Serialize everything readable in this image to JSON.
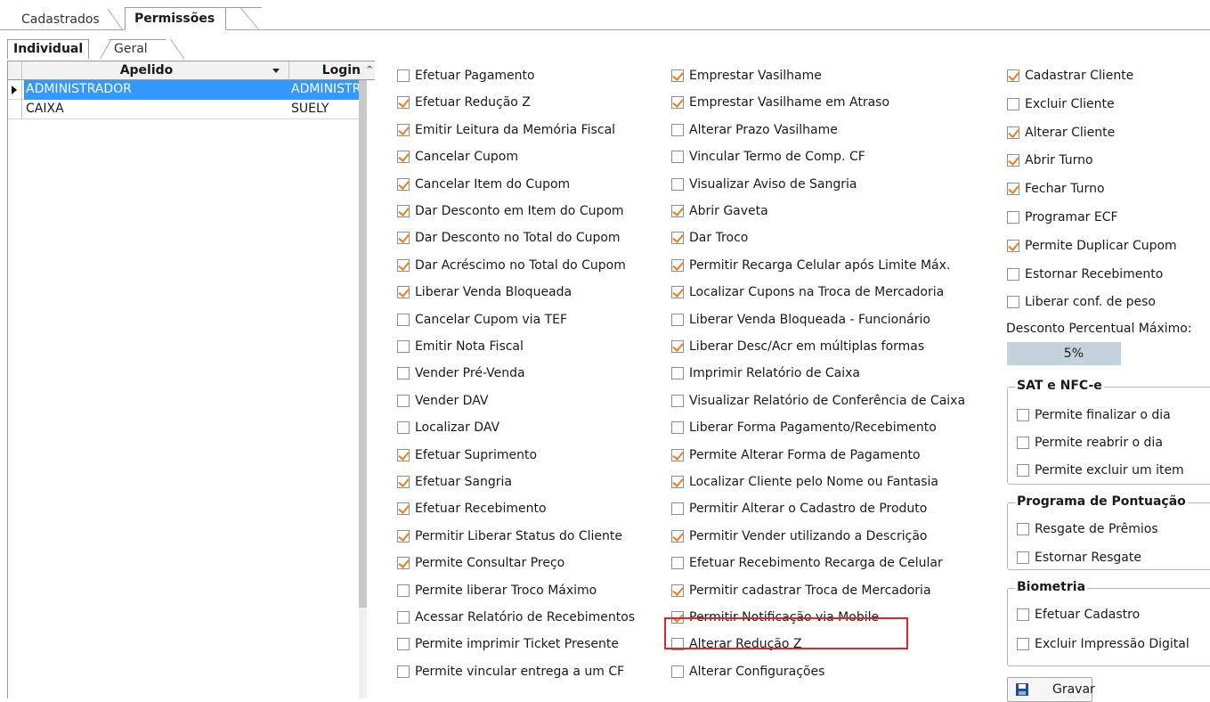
{
  "tabs": {
    "cadastrados": "Cadastrados",
    "permissoes": "Permissões"
  },
  "subtabs": {
    "individual": "Individual",
    "geral": "Geral"
  },
  "grid": {
    "headers": {
      "apelido": "Apelido",
      "login": "Login"
    },
    "rows": [
      {
        "apelido": "ADMINISTRADOR",
        "login": "ADMINISTR",
        "selected": true
      },
      {
        "apelido": "CAIXA",
        "login": "SUELY",
        "selected": false
      }
    ]
  },
  "col1": [
    {
      "label": "Efetuar Pagamento",
      "checked": false
    },
    {
      "label": "Efetuar Redução Z",
      "checked": true
    },
    {
      "label": "Emitir Leitura da Memória Fiscal",
      "checked": true
    },
    {
      "label": "Cancelar Cupom",
      "checked": true
    },
    {
      "label": "Cancelar Item do Cupom",
      "checked": true
    },
    {
      "label": "Dar Desconto em Item do Cupom",
      "checked": true
    },
    {
      "label": "Dar Desconto no Total do Cupom",
      "checked": true
    },
    {
      "label": "Dar Acréscimo no Total do Cupom",
      "checked": true
    },
    {
      "label": "Liberar Venda Bloqueada",
      "checked": true
    },
    {
      "label": "Cancelar Cupom via TEF",
      "checked": false
    },
    {
      "label": "Emitir Nota Fiscal",
      "checked": false
    },
    {
      "label": "Vender Pré-Venda",
      "checked": false
    },
    {
      "label": "Vender DAV",
      "checked": false
    },
    {
      "label": "Localizar DAV",
      "checked": false
    },
    {
      "label": "Efetuar Suprimento",
      "checked": true
    },
    {
      "label": "Efetuar Sangria",
      "checked": true
    },
    {
      "label": "Efetuar Recebimento",
      "checked": true
    },
    {
      "label": "Permitir Liberar Status do Cliente",
      "checked": true
    },
    {
      "label": "Permite Consultar Preço",
      "checked": true
    },
    {
      "label": "Permite liberar Troco Máximo",
      "checked": false
    },
    {
      "label": "Acessar Relatório de Recebimentos",
      "checked": false
    },
    {
      "label": "Permite imprimir Ticket Presente",
      "checked": false
    },
    {
      "label": "Permite vincular entrega a um CF",
      "checked": false
    }
  ],
  "col2": [
    {
      "label": "Emprestar Vasilhame",
      "checked": true
    },
    {
      "label": "Emprestar Vasilhame em Atraso",
      "checked": true
    },
    {
      "label": "Alterar Prazo Vasilhame",
      "checked": false
    },
    {
      "label": "Vincular Termo de Comp. CF",
      "checked": false
    },
    {
      "label": "Visualizar Aviso de Sangria",
      "checked": false
    },
    {
      "label": "Abrir Gaveta",
      "checked": true
    },
    {
      "label": "Dar Troco",
      "checked": true
    },
    {
      "label": "Permitir Recarga Celular após Limite Máx.",
      "checked": true
    },
    {
      "label": "Localizar Cupons na Troca de Mercadoria",
      "checked": true
    },
    {
      "label": "Liberar Venda Bloqueada - Funcionário",
      "checked": false
    },
    {
      "label": "Liberar Desc/Acr em múltiplas formas",
      "checked": true
    },
    {
      "label": "Imprimir Relatório de Caixa",
      "checked": false
    },
    {
      "label": "Visualizar Relatório de Conferência de Caixa",
      "checked": false
    },
    {
      "label": "Liberar Forma Pagamento/Recebimento",
      "checked": false
    },
    {
      "label": "Permite Alterar Forma de Pagamento",
      "checked": true
    },
    {
      "label": "Localizar Cliente pelo Nome ou Fantasia",
      "checked": true
    },
    {
      "label": "Permitir Alterar o Cadastro de Produto",
      "checked": false
    },
    {
      "label": "Permitir Vender utilizando a Descrição",
      "checked": true
    },
    {
      "label": "Efetuar Recebimento Recarga de Celular",
      "checked": false
    },
    {
      "label": "Permitir cadastrar Troca de Mercadoria",
      "checked": true
    },
    {
      "label": "Permitir Notificação via Mobile",
      "checked": true
    },
    {
      "label": "Alterar Redução Z",
      "checked": false
    },
    {
      "label": "Alterar Configurações",
      "checked": false
    }
  ],
  "col3": [
    {
      "label": "Cadastrar Cliente",
      "checked": true
    },
    {
      "label": "Excluir Cliente",
      "checked": false
    },
    {
      "label": "Alterar Cliente",
      "checked": true
    },
    {
      "label": "Abrir Turno",
      "checked": true
    },
    {
      "label": "Fechar Turno",
      "checked": true
    },
    {
      "label": "Programar ECF",
      "checked": false
    },
    {
      "label": "Permite Duplicar Cupom",
      "checked": true
    },
    {
      "label": "Estornar Recebimento",
      "checked": false
    },
    {
      "label": "Liberar conf. de peso",
      "checked": false
    }
  ],
  "desconto": {
    "label": "Desconto Percentual Máximo:",
    "value": "5%"
  },
  "sat": {
    "title": "SAT e NFC-e",
    "items": [
      {
        "label": "Permite finalizar o dia",
        "checked": false
      },
      {
        "label": "Permite reabrir o dia",
        "checked": false
      },
      {
        "label": "Permite excluir um item",
        "checked": false
      }
    ]
  },
  "pontuacao": {
    "title": "Programa de Pontuação",
    "items": [
      {
        "label": "Resgate de Prêmios",
        "checked": false
      },
      {
        "label": "Estornar Resgate",
        "checked": false
      }
    ]
  },
  "biometria": {
    "title": "Biometria",
    "items": [
      {
        "label": "Efetuar Cadastro",
        "checked": false
      },
      {
        "label": "Excluir Impressão Digital",
        "checked": false
      }
    ]
  },
  "gravar": "Gravar"
}
